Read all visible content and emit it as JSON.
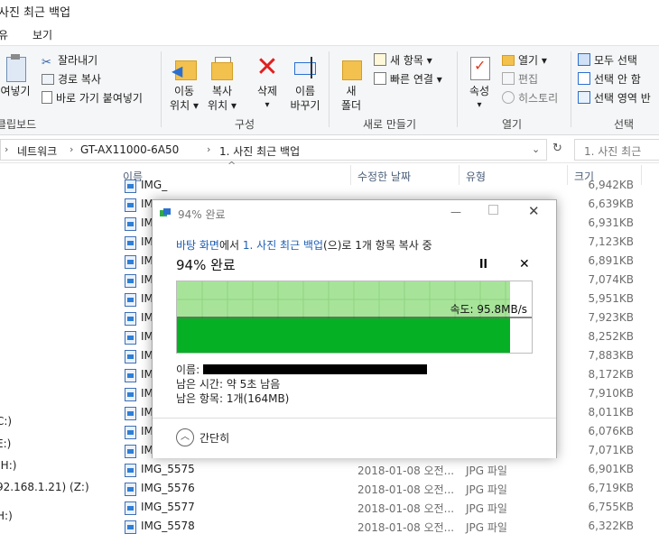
{
  "window": {
    "title": "사진 최근 백업"
  },
  "menu": {
    "tabs": [
      "유",
      "보기"
    ]
  },
  "ribbon": {
    "clipboard": {
      "label": "클립보드",
      "paste_label": "여넣기",
      "cut": "잘라내기",
      "copy_path": "경로 복사",
      "paste_shortcut": "바로 가기 붙여넣기"
    },
    "organize": {
      "label": "구성",
      "move_to": [
        "이동",
        "위치"
      ],
      "copy_to": [
        "복사",
        "위치"
      ],
      "delete": "삭제",
      "rename": [
        "이름",
        "바꾸기"
      ]
    },
    "new": {
      "label": "새로 만들기",
      "new_folder": [
        "새",
        "폴더"
      ],
      "new_item": "새 항목",
      "easy_access": "빠른 연결"
    },
    "open": {
      "label": "열기",
      "properties": "속성",
      "open": "열기",
      "edit": "편집",
      "history": "히스토리"
    },
    "select": {
      "label": "선택",
      "select_all": "모두 선택",
      "select_none": "선택 안 함",
      "invert": "선택 영역 반"
    }
  },
  "address": {
    "crumbs": [
      "네트워크",
      "GT-AX11000-6A50",
      "1. 사진 최근 백업"
    ],
    "search_placeholder": "1. 사진 최근"
  },
  "columns": [
    "이름",
    "수정한 날짜",
    "유형",
    "크기"
  ],
  "nav": [
    "C:)",
    "E:)",
    "(H:)",
    "92.168.1.21) (Z:)",
    "H:)"
  ],
  "files": [
    {
      "name": "IMG_",
      "date": "",
      "type": "",
      "size": "6,942KB"
    },
    {
      "name": "IMG_",
      "date": "",
      "type": "",
      "size": "6,639KB"
    },
    {
      "name": "IMG_",
      "date": "",
      "type": "",
      "size": "6,931KB"
    },
    {
      "name": "IMG_",
      "date": "",
      "type": "",
      "size": "7,123KB"
    },
    {
      "name": "IMG_",
      "date": "",
      "type": "",
      "size": "6,891KB"
    },
    {
      "name": "IMG_",
      "date": "",
      "type": "",
      "size": "7,074KB"
    },
    {
      "name": "IMG_",
      "date": "",
      "type": "",
      "size": "5,951KB"
    },
    {
      "name": "IMG_",
      "date": "",
      "type": "",
      "size": "7,923KB"
    },
    {
      "name": "IMG_",
      "date": "",
      "type": "",
      "size": "8,252KB"
    },
    {
      "name": "IMG_",
      "date": "",
      "type": "",
      "size": "7,883KB"
    },
    {
      "name": "IMG_",
      "date": "",
      "type": "",
      "size": "8,172KB"
    },
    {
      "name": "IMG_",
      "date": "",
      "type": "",
      "size": "7,910KB"
    },
    {
      "name": "IMG_",
      "date": "",
      "type": "",
      "size": "8,011KB"
    },
    {
      "name": "IMG_",
      "date": "",
      "type": "",
      "size": "6,076KB"
    },
    {
      "name": "IMG_5574",
      "date": "2018-01-08 오전...",
      "type": "JPG 파일",
      "size": "7,071KB"
    },
    {
      "name": "IMG_5575",
      "date": "2018-01-08 오전...",
      "type": "JPG 파일",
      "size": "6,901KB"
    },
    {
      "name": "IMG_5576",
      "date": "2018-01-08 오전...",
      "type": "JPG 파일",
      "size": "6,719KB"
    },
    {
      "name": "IMG_5577",
      "date": "2018-01-08 오전...",
      "type": "JPG 파일",
      "size": "6,755KB"
    },
    {
      "name": "IMG_5578",
      "date": "2018-01-08 오전...",
      "type": "JPG 파일",
      "size": "6,322KB"
    }
  ],
  "dialog": {
    "title": "94% 완료",
    "status_from": "바탕 화면",
    "status_mid1": "에서 ",
    "status_to": "1. 사진 최근 백업",
    "status_mid2": "(으)로 1개 항목 복사 중",
    "percent": "94% 완료",
    "progress": 0.94,
    "speed": "속도: 95.8MB/s",
    "name_label": "이름:",
    "time_remaining": "남은 시간: 약 5초 남음",
    "items_remaining": "남은 항목: 1개(164MB)",
    "less_details": "간단히"
  },
  "colors": {
    "progress_fill": "#06b025",
    "progress_band": "#a7e49a",
    "link": "#1e5fb4",
    "close_red": "#e02020"
  }
}
